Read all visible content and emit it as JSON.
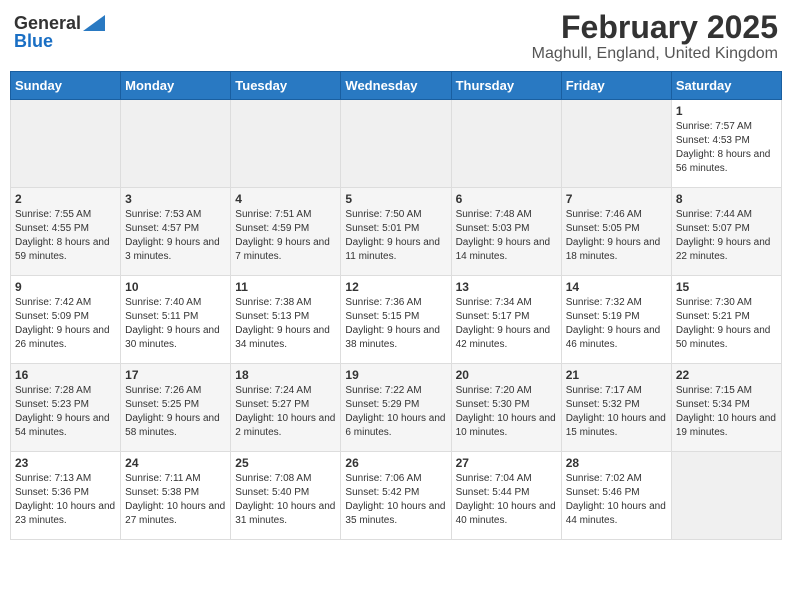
{
  "header": {
    "logo_general": "General",
    "logo_blue": "Blue",
    "main_title": "February 2025",
    "subtitle": "Maghull, England, United Kingdom"
  },
  "calendar": {
    "days_of_week": [
      "Sunday",
      "Monday",
      "Tuesday",
      "Wednesday",
      "Thursday",
      "Friday",
      "Saturday"
    ],
    "weeks": [
      [
        {
          "day": "",
          "info": ""
        },
        {
          "day": "",
          "info": ""
        },
        {
          "day": "",
          "info": ""
        },
        {
          "day": "",
          "info": ""
        },
        {
          "day": "",
          "info": ""
        },
        {
          "day": "",
          "info": ""
        },
        {
          "day": "1",
          "info": "Sunrise: 7:57 AM\nSunset: 4:53 PM\nDaylight: 8 hours\nand 56 minutes."
        }
      ],
      [
        {
          "day": "2",
          "info": "Sunrise: 7:55 AM\nSunset: 4:55 PM\nDaylight: 8 hours\nand 59 minutes."
        },
        {
          "day": "3",
          "info": "Sunrise: 7:53 AM\nSunset: 4:57 PM\nDaylight: 9 hours\nand 3 minutes."
        },
        {
          "day": "4",
          "info": "Sunrise: 7:51 AM\nSunset: 4:59 PM\nDaylight: 9 hours\nand 7 minutes."
        },
        {
          "day": "5",
          "info": "Sunrise: 7:50 AM\nSunset: 5:01 PM\nDaylight: 9 hours\nand 11 minutes."
        },
        {
          "day": "6",
          "info": "Sunrise: 7:48 AM\nSunset: 5:03 PM\nDaylight: 9 hours\nand 14 minutes."
        },
        {
          "day": "7",
          "info": "Sunrise: 7:46 AM\nSunset: 5:05 PM\nDaylight: 9 hours\nand 18 minutes."
        },
        {
          "day": "8",
          "info": "Sunrise: 7:44 AM\nSunset: 5:07 PM\nDaylight: 9 hours\nand 22 minutes."
        }
      ],
      [
        {
          "day": "9",
          "info": "Sunrise: 7:42 AM\nSunset: 5:09 PM\nDaylight: 9 hours\nand 26 minutes."
        },
        {
          "day": "10",
          "info": "Sunrise: 7:40 AM\nSunset: 5:11 PM\nDaylight: 9 hours\nand 30 minutes."
        },
        {
          "day": "11",
          "info": "Sunrise: 7:38 AM\nSunset: 5:13 PM\nDaylight: 9 hours\nand 34 minutes."
        },
        {
          "day": "12",
          "info": "Sunrise: 7:36 AM\nSunset: 5:15 PM\nDaylight: 9 hours\nand 38 minutes."
        },
        {
          "day": "13",
          "info": "Sunrise: 7:34 AM\nSunset: 5:17 PM\nDaylight: 9 hours\nand 42 minutes."
        },
        {
          "day": "14",
          "info": "Sunrise: 7:32 AM\nSunset: 5:19 PM\nDaylight: 9 hours\nand 46 minutes."
        },
        {
          "day": "15",
          "info": "Sunrise: 7:30 AM\nSunset: 5:21 PM\nDaylight: 9 hours\nand 50 minutes."
        }
      ],
      [
        {
          "day": "16",
          "info": "Sunrise: 7:28 AM\nSunset: 5:23 PM\nDaylight: 9 hours\nand 54 minutes."
        },
        {
          "day": "17",
          "info": "Sunrise: 7:26 AM\nSunset: 5:25 PM\nDaylight: 9 hours\nand 58 minutes."
        },
        {
          "day": "18",
          "info": "Sunrise: 7:24 AM\nSunset: 5:27 PM\nDaylight: 10 hours\nand 2 minutes."
        },
        {
          "day": "19",
          "info": "Sunrise: 7:22 AM\nSunset: 5:29 PM\nDaylight: 10 hours\nand 6 minutes."
        },
        {
          "day": "20",
          "info": "Sunrise: 7:20 AM\nSunset: 5:30 PM\nDaylight: 10 hours\nand 10 minutes."
        },
        {
          "day": "21",
          "info": "Sunrise: 7:17 AM\nSunset: 5:32 PM\nDaylight: 10 hours\nand 15 minutes."
        },
        {
          "day": "22",
          "info": "Sunrise: 7:15 AM\nSunset: 5:34 PM\nDaylight: 10 hours\nand 19 minutes."
        }
      ],
      [
        {
          "day": "23",
          "info": "Sunrise: 7:13 AM\nSunset: 5:36 PM\nDaylight: 10 hours\nand 23 minutes."
        },
        {
          "day": "24",
          "info": "Sunrise: 7:11 AM\nSunset: 5:38 PM\nDaylight: 10 hours\nand 27 minutes."
        },
        {
          "day": "25",
          "info": "Sunrise: 7:08 AM\nSunset: 5:40 PM\nDaylight: 10 hours\nand 31 minutes."
        },
        {
          "day": "26",
          "info": "Sunrise: 7:06 AM\nSunset: 5:42 PM\nDaylight: 10 hours\nand 35 minutes."
        },
        {
          "day": "27",
          "info": "Sunrise: 7:04 AM\nSunset: 5:44 PM\nDaylight: 10 hours\nand 40 minutes."
        },
        {
          "day": "28",
          "info": "Sunrise: 7:02 AM\nSunset: 5:46 PM\nDaylight: 10 hours\nand 44 minutes."
        },
        {
          "day": "",
          "info": ""
        }
      ]
    ]
  }
}
